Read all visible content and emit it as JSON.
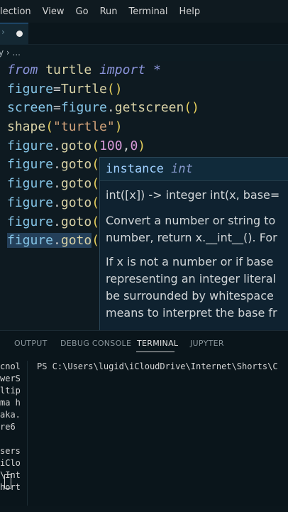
{
  "menubar": {
    "items": [
      "election",
      "View",
      "Go",
      "Run",
      "Terminal",
      "Help"
    ]
  },
  "breadcrumb": {
    "text": "y › ..."
  },
  "editor": {
    "lines": [
      [
        {
          "t": "from",
          "c": "kw"
        },
        {
          "t": " "
        },
        {
          "t": "turtle",
          "c": "mod"
        },
        {
          "t": " "
        },
        {
          "t": "import",
          "c": "kw"
        },
        {
          "t": " "
        },
        {
          "t": "*",
          "c": "kw"
        }
      ],
      [
        {
          "t": "figure",
          "c": "id"
        },
        {
          "t": "=",
          "c": "punct"
        },
        {
          "t": "Turtle",
          "c": "mod"
        },
        {
          "t": "()",
          "c": "paren"
        }
      ],
      [
        {
          "t": "screen",
          "c": "id"
        },
        {
          "t": "=",
          "c": "punct"
        },
        {
          "t": "figure",
          "c": "id"
        },
        {
          "t": ".",
          "c": "punct"
        },
        {
          "t": "getscreen",
          "c": "mod"
        },
        {
          "t": "()",
          "c": "paren"
        }
      ],
      [
        {
          "t": "shape",
          "c": "mod"
        },
        {
          "t": "(",
          "c": "paren"
        },
        {
          "t": "\"turtle\"",
          "c": "str"
        },
        {
          "t": ")",
          "c": "paren"
        }
      ],
      [
        {
          "t": "figure",
          "c": "id"
        },
        {
          "t": ".",
          "c": "punct"
        },
        {
          "t": "goto",
          "c": "mod"
        },
        {
          "t": "(",
          "c": "paren"
        },
        {
          "t": "100",
          "c": "num"
        },
        {
          "t": ",",
          "c": "punct"
        },
        {
          "t": "0",
          "c": "num"
        },
        {
          "t": ")",
          "c": "paren"
        }
      ],
      [
        {
          "t": "figure",
          "c": "id"
        },
        {
          "t": ".",
          "c": "punct"
        },
        {
          "t": "goto",
          "c": "mod"
        },
        {
          "t": "(",
          "c": "paren"
        }
      ],
      [
        {
          "t": "figure",
          "c": "id"
        },
        {
          "t": ".",
          "c": "punct"
        },
        {
          "t": "goto",
          "c": "mod"
        },
        {
          "t": "(",
          "c": "paren"
        }
      ],
      [
        {
          "t": "figure",
          "c": "id"
        },
        {
          "t": ".",
          "c": "punct"
        },
        {
          "t": "goto",
          "c": "mod"
        },
        {
          "t": "(",
          "c": "paren"
        }
      ],
      [
        {
          "t": "figure",
          "c": "id"
        },
        {
          "t": ".",
          "c": "punct"
        },
        {
          "t": "goto",
          "c": "mod"
        },
        {
          "t": "(",
          "c": "paren"
        }
      ],
      [
        {
          "t": "figure",
          "c": "id",
          "sel": true
        },
        {
          "t": ".",
          "c": "punct",
          "sel": true
        },
        {
          "t": "goto",
          "c": "mod",
          "sel": true
        },
        {
          "t": "(",
          "c": "paren"
        }
      ]
    ]
  },
  "hover": {
    "header_left": "instance",
    "header_right": "int",
    "signature": "int([x]) -> integer int(x, base=",
    "para1_line1": "Convert a number or string to",
    "para1_line2": "number, return x.__int__(). For",
    "para2_line1": "If x is not a number or if base",
    "para2_line2": "representing an integer literal",
    "para2_line3": "be surrounded by whitespace",
    "para2_line4": "means to interpret the base fr"
  },
  "panel": {
    "tabs": [
      "OUTPUT",
      "DEBUG CONSOLE",
      "TERMINAL",
      "JUPYTER"
    ],
    "active_tab": "TERMINAL"
  },
  "terminal": {
    "left_lines": [
      "cnol",
      "werS",
      "ltip",
      "ma h",
      "aka.",
      "re6",
      "",
      "sers",
      "iClo",
      "\\Int",
      "hort"
    ],
    "prompt": "PS C:\\Users\\lugid\\iCloudDrive\\Internet\\Shorts\\C"
  }
}
